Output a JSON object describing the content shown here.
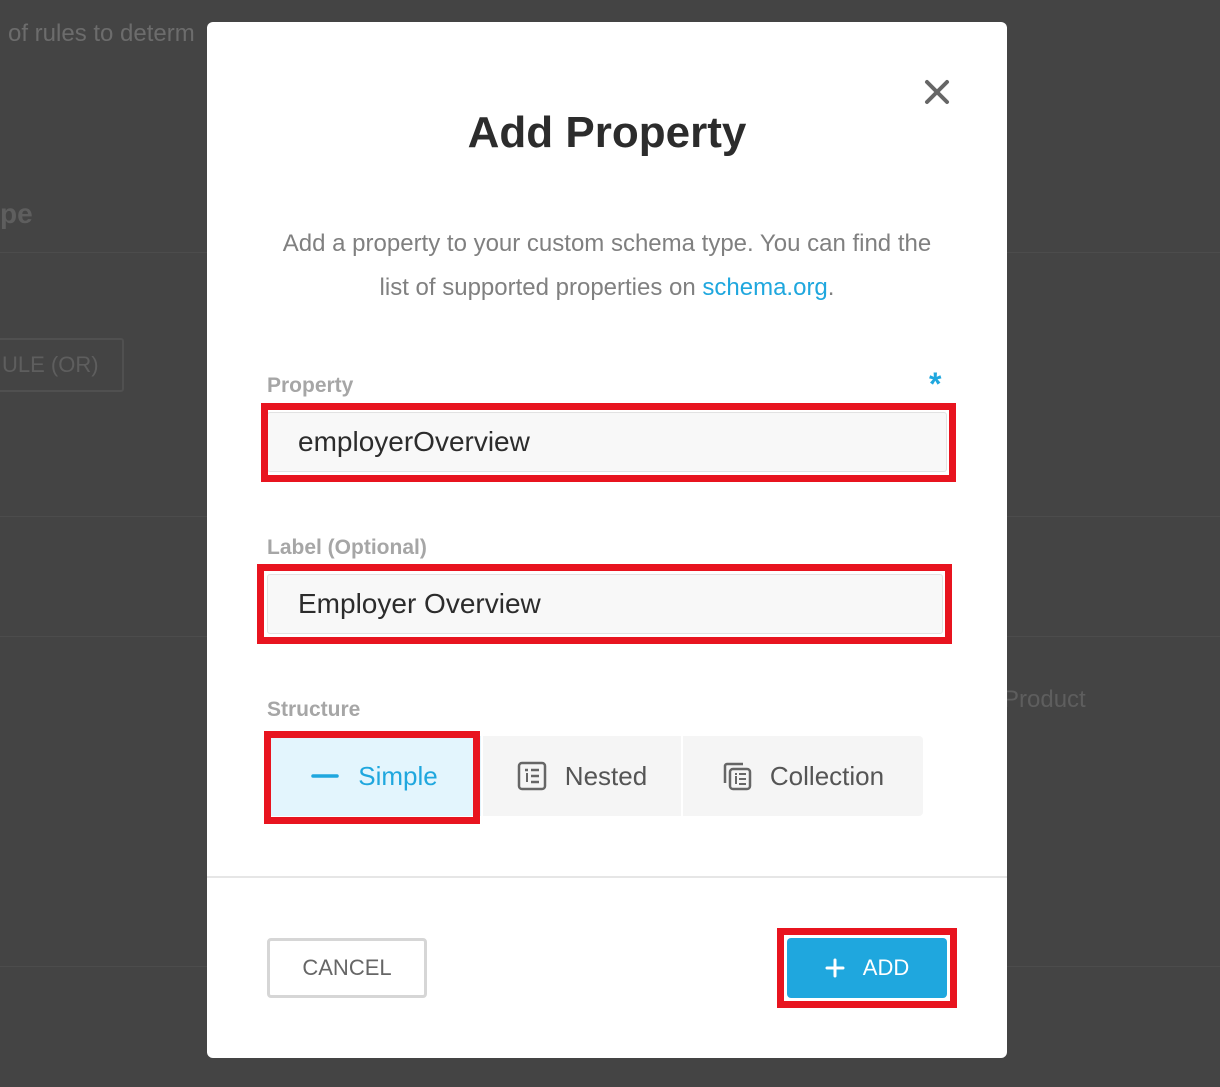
{
  "background": {
    "intro_text": "of rules to determ",
    "heading_text": "pe",
    "rule_button_label": "ULE (OR)",
    "product_text": "Product"
  },
  "modal": {
    "title": "Add Property",
    "description_before": "Add a property to your custom schema type. You can find the list of supported properties on ",
    "description_link": "schema.org",
    "description_after": ".",
    "close_icon": "close-icon",
    "property": {
      "label": "Property",
      "required_mark": "*",
      "value": "employerOverview"
    },
    "label_field": {
      "label": "Label (Optional)",
      "value": "Employer Overview"
    },
    "structure": {
      "label": "Structure",
      "options": [
        {
          "label": "Simple",
          "icon": "dash-icon",
          "selected": true
        },
        {
          "label": "Nested",
          "icon": "nested-list-icon",
          "selected": false
        },
        {
          "label": "Collection",
          "icon": "collection-icon",
          "selected": false
        }
      ]
    },
    "cancel_label": "CANCEL",
    "add_label": "ADD"
  },
  "colors": {
    "accent": "#1fa7de",
    "highlight": "#e8141f",
    "overlay": "#444444"
  }
}
